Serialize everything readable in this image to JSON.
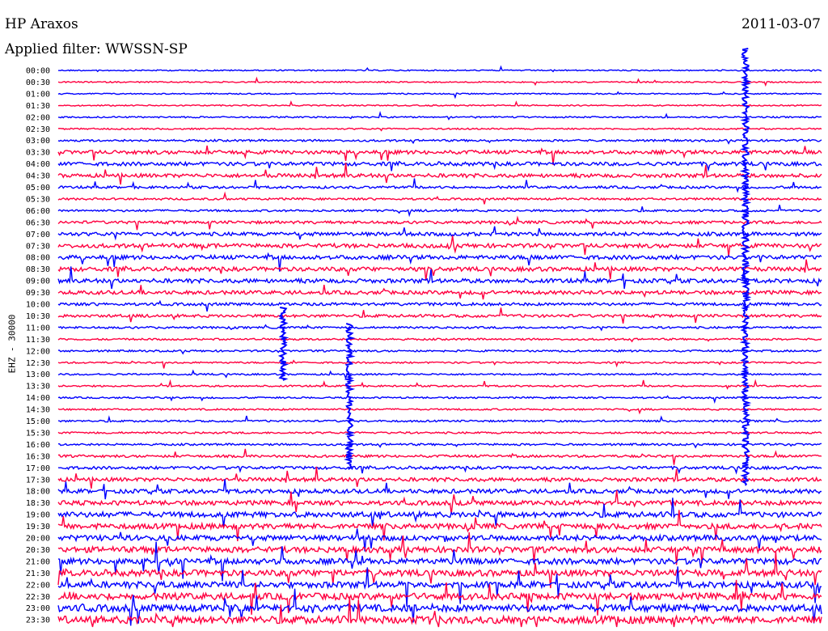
{
  "header": {
    "station": "HP Araxos",
    "filter": "Applied filter: WWSSN-SP",
    "date": "2011-03-07"
  },
  "chart_data": {
    "type": "line",
    "title": "HP Araxos",
    "subtitle": "Applied filter: WWSSN-SP",
    "date": "2011-03-07",
    "ylabel": "EHZ - 30000",
    "xlabel": "",
    "row_labels": [
      "00:00",
      "00:30",
      "01:00",
      "01:30",
      "02:00",
      "02:30",
      "03:00",
      "03:30",
      "04:00",
      "04:30",
      "05:00",
      "05:30",
      "06:00",
      "06:30",
      "07:00",
      "07:30",
      "08:00",
      "08:30",
      "09:00",
      "09:30",
      "10:00",
      "10:30",
      "11:00",
      "11:30",
      "12:00",
      "12:30",
      "13:00",
      "13:30",
      "14:00",
      "14:30",
      "15:00",
      "15:30",
      "16:00",
      "16:30",
      "17:00",
      "17:30",
      "18:00",
      "18:30",
      "19:00",
      "19:30",
      "20:00",
      "20:30",
      "21:00",
      "21:30",
      "22:00",
      "22:30",
      "23:00",
      "23:30"
    ],
    "series_colors": [
      "#0000ff",
      "#ff0040"
    ],
    "noise_level": [
      0.3,
      0.3,
      0.3,
      0.3,
      0.35,
      0.35,
      0.5,
      0.9,
      0.9,
      0.9,
      0.6,
      0.5,
      0.5,
      0.7,
      0.9,
      1.0,
      1.0,
      1.0,
      1.0,
      0.9,
      0.7,
      0.7,
      0.5,
      0.45,
      0.45,
      0.4,
      0.4,
      0.4,
      0.4,
      0.4,
      0.45,
      0.45,
      0.5,
      0.6,
      0.7,
      0.9,
      1.0,
      1.1,
      1.3,
      1.3,
      1.3,
      1.4,
      1.4,
      1.5,
      1.5,
      1.6,
      1.7,
      1.8
    ],
    "grid": false,
    "legend": "none"
  }
}
